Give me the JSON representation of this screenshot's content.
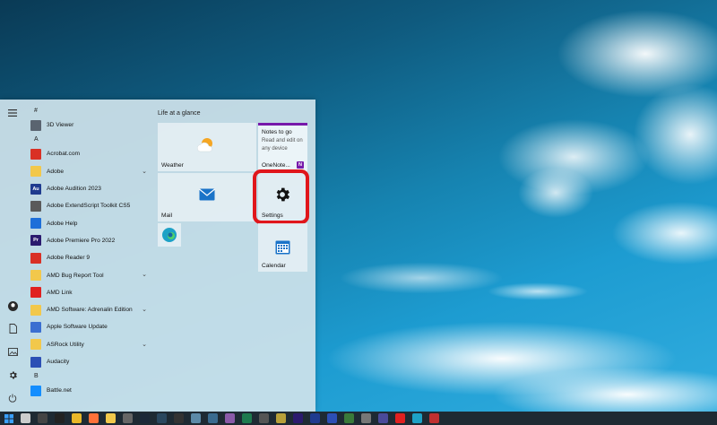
{
  "start_menu": {
    "tiles_header": "Life at a glance",
    "app_list": [
      {
        "type": "header",
        "label": "#"
      },
      {
        "type": "app",
        "label": "3D Viewer",
        "icon": "cube-icon",
        "color": "#5a6470"
      },
      {
        "type": "header",
        "label": "A"
      },
      {
        "type": "app",
        "label": "Acrobat.com",
        "icon": "acrobat-icon",
        "color": "#d93025"
      },
      {
        "type": "folder",
        "label": "Adobe",
        "icon": "folder-icon",
        "color": "#f2c84b"
      },
      {
        "type": "app",
        "label": "Adobe Audition 2023",
        "icon": "audition-icon",
        "color": "#1f3b8f",
        "abbr": "Au"
      },
      {
        "type": "app",
        "label": "Adobe ExtendScript Toolkit CS5",
        "icon": "extendscript-icon",
        "color": "#5a5a5a"
      },
      {
        "type": "app",
        "label": "Adobe Help",
        "icon": "help-icon",
        "color": "#1e6fd9"
      },
      {
        "type": "app",
        "label": "Adobe Premiere Pro 2022",
        "icon": "premiere-icon",
        "color": "#2b1a6e",
        "abbr": "Pr"
      },
      {
        "type": "app",
        "label": "Adobe Reader 9",
        "icon": "reader-icon",
        "color": "#d93025"
      },
      {
        "type": "folder",
        "label": "AMD Bug Report Tool",
        "icon": "folder-icon",
        "color": "#f2c84b"
      },
      {
        "type": "app",
        "label": "AMD Link",
        "icon": "amd-link-icon",
        "color": "#e02020"
      },
      {
        "type": "folder",
        "label": "AMD Software: Adrenalin Edition",
        "icon": "folder-icon",
        "color": "#f2c84b"
      },
      {
        "type": "app",
        "label": "Apple Software Update",
        "icon": "apple-update-icon",
        "color": "#3b6fd1"
      },
      {
        "type": "folder",
        "label": "ASRock Utility",
        "icon": "folder-icon",
        "color": "#f2c84b"
      },
      {
        "type": "app",
        "label": "Audacity",
        "icon": "audacity-icon",
        "color": "#2c4fb5"
      },
      {
        "type": "header",
        "label": "B"
      },
      {
        "type": "app",
        "label": "Battle.net",
        "icon": "battlenet-icon",
        "color": "#148eff"
      }
    ],
    "tiles": {
      "weather_label": "Weather",
      "mail_label": "Mail",
      "settings_label": "Settings",
      "calendar_label": "Calendar",
      "onenote_title": "Notes to go",
      "onenote_desc": "Read and edit on any device",
      "onenote_label": "OneNote..."
    },
    "highlight_color": "#e0161b",
    "accent_color": "#7719aa"
  },
  "taskbar": {
    "icons": [
      {
        "name": "start-icon",
        "color": "#3aa0ff"
      },
      {
        "name": "task-view-icon",
        "color": "#cccccc"
      },
      {
        "name": "app-icon",
        "color": "#444444"
      },
      {
        "name": "terminal-icon",
        "color": "#222222"
      },
      {
        "name": "chrome-icon",
        "color": "#e9b829"
      },
      {
        "name": "firefox-icon",
        "color": "#ff7139"
      },
      {
        "name": "file-explorer-icon",
        "color": "#f2c84b"
      },
      {
        "name": "app-icon",
        "color": "#666666"
      },
      {
        "name": "steam-icon",
        "color": "#1b2838"
      },
      {
        "name": "steam-icon",
        "color": "#2a475e"
      },
      {
        "name": "github-icon",
        "color": "#333333"
      },
      {
        "name": "app-icon",
        "color": "#5c8aa8"
      },
      {
        "name": "app-icon",
        "color": "#3a6b8f"
      },
      {
        "name": "app-icon",
        "color": "#8a5aa8"
      },
      {
        "name": "app-icon",
        "color": "#1e7a4e"
      },
      {
        "name": "app-icon",
        "color": "#555555"
      },
      {
        "name": "app-icon",
        "color": "#b8a03a"
      },
      {
        "name": "premiere-icon",
        "color": "#2b1a6e"
      },
      {
        "name": "audition-icon",
        "color": "#1f3b8f"
      },
      {
        "name": "audacity-icon",
        "color": "#2c4fb5"
      },
      {
        "name": "app-icon",
        "color": "#3a7a3a"
      },
      {
        "name": "app-icon",
        "color": "#777777"
      },
      {
        "name": "app-icon",
        "color": "#4a4a9a"
      },
      {
        "name": "amd-icon",
        "color": "#e02020"
      },
      {
        "name": "edge-icon",
        "color": "#1da1c6"
      },
      {
        "name": "app-icon",
        "color": "#c03030"
      }
    ]
  }
}
